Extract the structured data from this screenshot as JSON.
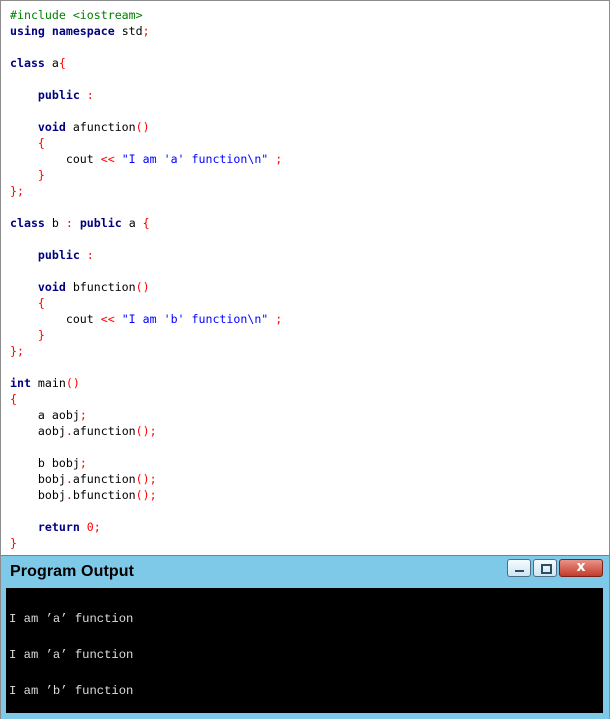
{
  "code_lines": [
    [
      {
        "t": "#include <iostream>",
        "c": "pre"
      }
    ],
    [
      {
        "t": "using",
        "c": "kw"
      },
      {
        "t": " ",
        "c": "ws"
      },
      {
        "t": "namespace",
        "c": "kw"
      },
      {
        "t": " std",
        "c": "id"
      },
      {
        "t": ";",
        "c": "sym"
      }
    ],
    [],
    [
      {
        "t": "class",
        "c": "kw"
      },
      {
        "t": " a",
        "c": "id"
      },
      {
        "t": "{",
        "c": "sym"
      }
    ],
    [],
    [
      {
        "t": "    ",
        "c": "ws"
      },
      {
        "t": "public",
        "c": "kw"
      },
      {
        "t": " ",
        "c": "ws"
      },
      {
        "t": ":",
        "c": "sym"
      }
    ],
    [],
    [
      {
        "t": "    ",
        "c": "ws"
      },
      {
        "t": "void",
        "c": "kw"
      },
      {
        "t": " afunction",
        "c": "id"
      },
      {
        "t": "()",
        "c": "sym"
      }
    ],
    [
      {
        "t": "    ",
        "c": "ws"
      },
      {
        "t": "{",
        "c": "sym"
      }
    ],
    [
      {
        "t": "        cout ",
        "c": "id"
      },
      {
        "t": "<<",
        "c": "sym"
      },
      {
        "t": " ",
        "c": "ws"
      },
      {
        "t": "\"I am 'a' function\\n\"",
        "c": "str"
      },
      {
        "t": " ",
        "c": "ws"
      },
      {
        "t": ";",
        "c": "sym"
      }
    ],
    [
      {
        "t": "    ",
        "c": "ws"
      },
      {
        "t": "}",
        "c": "sym"
      }
    ],
    [
      {
        "t": "};",
        "c": "sym"
      }
    ],
    [],
    [
      {
        "t": "class",
        "c": "kw"
      },
      {
        "t": " b ",
        "c": "id"
      },
      {
        "t": ":",
        "c": "sym"
      },
      {
        "t": " ",
        "c": "ws"
      },
      {
        "t": "public",
        "c": "kw"
      },
      {
        "t": " a ",
        "c": "id"
      },
      {
        "t": "{",
        "c": "sym"
      }
    ],
    [],
    [
      {
        "t": "    ",
        "c": "ws"
      },
      {
        "t": "public",
        "c": "kw"
      },
      {
        "t": " ",
        "c": "ws"
      },
      {
        "t": ":",
        "c": "sym"
      }
    ],
    [],
    [
      {
        "t": "    ",
        "c": "ws"
      },
      {
        "t": "void",
        "c": "kw"
      },
      {
        "t": " bfunction",
        "c": "id"
      },
      {
        "t": "()",
        "c": "sym"
      }
    ],
    [
      {
        "t": "    ",
        "c": "ws"
      },
      {
        "t": "{",
        "c": "sym"
      }
    ],
    [
      {
        "t": "        cout ",
        "c": "id"
      },
      {
        "t": "<<",
        "c": "sym"
      },
      {
        "t": " ",
        "c": "ws"
      },
      {
        "t": "\"I am 'b' function\\n\"",
        "c": "str"
      },
      {
        "t": " ",
        "c": "ws"
      },
      {
        "t": ";",
        "c": "sym"
      }
    ],
    [
      {
        "t": "    ",
        "c": "ws"
      },
      {
        "t": "}",
        "c": "sym"
      }
    ],
    [
      {
        "t": "};",
        "c": "sym"
      }
    ],
    [],
    [
      {
        "t": "int",
        "c": "kw"
      },
      {
        "t": " main",
        "c": "id"
      },
      {
        "t": "()",
        "c": "sym"
      }
    ],
    [
      {
        "t": "{",
        "c": "sym"
      }
    ],
    [
      {
        "t": "    a aobj",
        "c": "id"
      },
      {
        "t": ";",
        "c": "sym"
      }
    ],
    [
      {
        "t": "    aobj",
        "c": "id"
      },
      {
        "t": ".",
        "c": "sym"
      },
      {
        "t": "afunction",
        "c": "id"
      },
      {
        "t": "();",
        "c": "sym"
      }
    ],
    [],
    [
      {
        "t": "    b bobj",
        "c": "id"
      },
      {
        "t": ";",
        "c": "sym"
      }
    ],
    [
      {
        "t": "    bobj",
        "c": "id"
      },
      {
        "t": ".",
        "c": "sym"
      },
      {
        "t": "afunction",
        "c": "id"
      },
      {
        "t": "();",
        "c": "sym"
      }
    ],
    [
      {
        "t": "    bobj",
        "c": "id"
      },
      {
        "t": ".",
        "c": "sym"
      },
      {
        "t": "bfunction",
        "c": "id"
      },
      {
        "t": "();",
        "c": "sym"
      }
    ],
    [],
    [
      {
        "t": "    ",
        "c": "ws"
      },
      {
        "t": "return",
        "c": "kw"
      },
      {
        "t": " ",
        "c": "ws"
      },
      {
        "t": "0",
        "c": "num"
      },
      {
        "t": ";",
        "c": "sym"
      }
    ],
    [
      {
        "t": "}",
        "c": "sym"
      }
    ]
  ],
  "output_window": {
    "title": "Program Output",
    "close_label": "x",
    "lines": [
      "I am ’a’ function",
      "I am ’a’ function",
      "I am ’b’ function"
    ]
  },
  "colors": {
    "preprocessor": "#008000",
    "keyword": "#000080",
    "symbol": "#ff0000",
    "string": "#0000ff",
    "output_title_bar": "#7ec8e8",
    "console_background": "#000000",
    "console_text": "#dcdcdc"
  }
}
